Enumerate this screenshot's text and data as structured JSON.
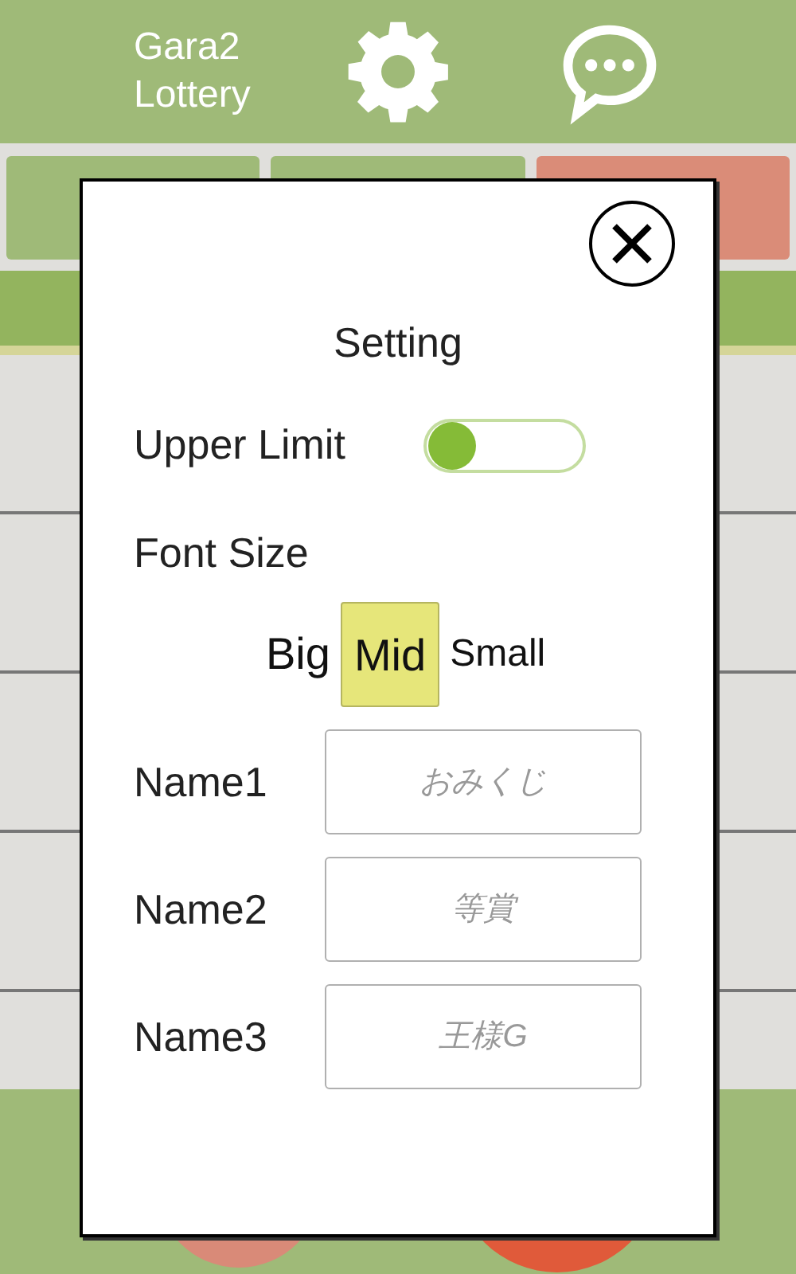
{
  "header": {
    "title_lines": [
      "Gara2",
      "Lottery"
    ]
  },
  "mode_buttons": [
    {
      "color": "#9fba78"
    },
    {
      "color": "#9fba78"
    },
    {
      "color": "#da8c78"
    }
  ],
  "dialog": {
    "title": "Setting",
    "upper_limit": {
      "label": "Upper Limit",
      "on": false
    },
    "font_size": {
      "label": "Font Size",
      "options": [
        {
          "label": "Big",
          "kind": "big",
          "selected": false
        },
        {
          "label": "Mid",
          "kind": "mid",
          "selected": true
        },
        {
          "label": "Small",
          "kind": "small",
          "selected": false
        }
      ]
    },
    "names": [
      {
        "label": "Name1",
        "placeholder": "おみくじ"
      },
      {
        "label": "Name2",
        "placeholder": "等賞"
      },
      {
        "label": "Name3",
        "placeholder": "王様G"
      }
    ]
  }
}
